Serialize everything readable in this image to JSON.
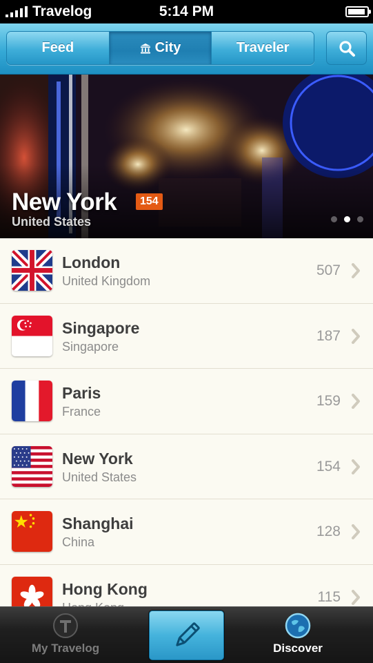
{
  "status_bar": {
    "carrier": "Travelog",
    "time": "5:14 PM"
  },
  "nav": {
    "segments": [
      {
        "label": "Feed",
        "active": false
      },
      {
        "label": "City",
        "active": true,
        "icon": "building-icon"
      },
      {
        "label": "Traveler",
        "active": false
      }
    ],
    "search_icon": "search-icon"
  },
  "hero": {
    "city": "New York",
    "count": "154",
    "country": "United States",
    "page_count": 3,
    "page_index": 2
  },
  "cities": [
    {
      "city": "London",
      "country": "United Kingdom",
      "count": "507",
      "flag": "uk-flag-icon"
    },
    {
      "city": "Singapore",
      "country": "Singapore",
      "count": "187",
      "flag": "singapore-flag-icon"
    },
    {
      "city": "Paris",
      "country": "France",
      "count": "159",
      "flag": "france-flag-icon"
    },
    {
      "city": "New York",
      "country": "United States",
      "count": "154",
      "flag": "usa-flag-icon"
    },
    {
      "city": "Shanghai",
      "country": "China",
      "count": "128",
      "flag": "china-flag-icon"
    },
    {
      "city": "Hong Kong",
      "country": "Hong Kong",
      "count": "115",
      "flag": "hong-kong-flag-icon"
    }
  ],
  "tab_bar": {
    "left": {
      "label": "My Travelog",
      "icon": "travelog-t-icon",
      "active": false
    },
    "center": {
      "icon": "pencil-icon"
    },
    "right": {
      "label": "Discover",
      "icon": "globe-icon",
      "active": true
    }
  },
  "colors": {
    "accent": "#35a9d6",
    "badge": "#e45a14",
    "list_bg": "#fbfaf2"
  }
}
